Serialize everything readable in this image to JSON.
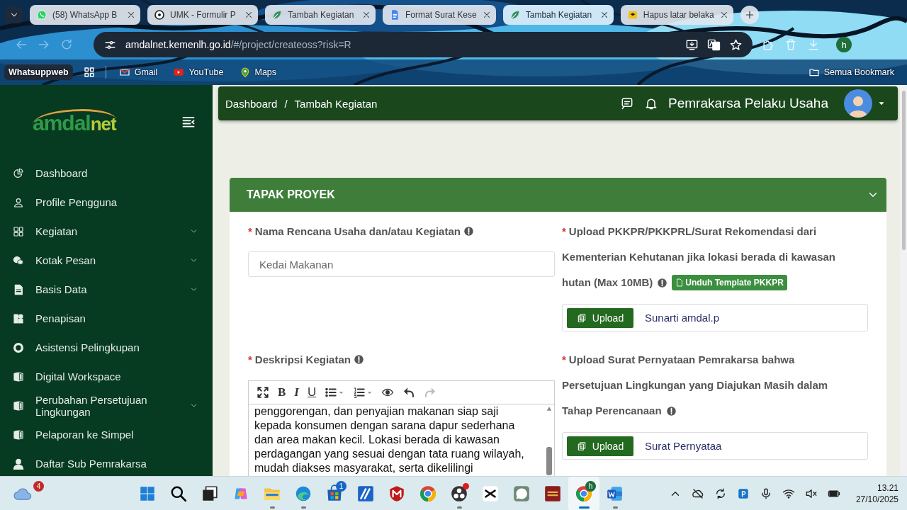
{
  "browser": {
    "tabs": [
      {
        "title": "(58) WhatsApp B",
        "kind": "chat",
        "selected": false
      },
      {
        "title": "UMK - Formulir P",
        "kind": "form",
        "selected": false
      },
      {
        "title": "Tambah Kegiatan",
        "kind": "leaf",
        "selected": false
      },
      {
        "title": "Format Surat Kese",
        "kind": "doc",
        "selected": false
      },
      {
        "title": "Tambah Kegiatan",
        "kind": "leaf",
        "selected": true
      },
      {
        "title": "Hapus latar belaka",
        "kind": "stack",
        "selected": false
      }
    ],
    "address": {
      "host": "amdalnet.kemenlh.go.id",
      "path": "/#/project/createoss?risk=R"
    },
    "profile_initial": "h",
    "bookmarks": [
      {
        "label": "Whatsuppweb",
        "kind": "chip"
      },
      {
        "label": "Gmail",
        "kind": "mail"
      },
      {
        "label": "YouTube",
        "kind": "video"
      },
      {
        "label": "Maps",
        "kind": "pin"
      }
    ],
    "all_bookmarks": "Semua Bookmark"
  },
  "app": {
    "logo": {
      "first": "amdal",
      "second": "net"
    },
    "sidebar": [
      {
        "label": "Dashboard",
        "kind": "pie",
        "has_submenu": false
      },
      {
        "label": "Profile Pengguna",
        "kind": "person",
        "has_submenu": false
      },
      {
        "label": "Kegiatan",
        "kind": "tiles",
        "has_submenu": true
      },
      {
        "label": "Kotak Pesan",
        "kind": "bubbles",
        "has_submenu": true
      },
      {
        "label": "Basis Data",
        "kind": "sheet",
        "has_submenu": true
      },
      {
        "label": "Penapisan",
        "kind": "squares",
        "has_submenu": false
      },
      {
        "label": "Asistensi Pelingkupan",
        "kind": "lifebuoy",
        "has_submenu": false
      },
      {
        "label": "Digital Workspace",
        "kind": "book",
        "has_submenu": false
      },
      {
        "label": "Perubahan Persetujuan Lingkungan",
        "kind": "book",
        "has_submenu": true
      },
      {
        "label": "Pelaporan ke Simpel",
        "kind": "book",
        "has_submenu": false
      },
      {
        "label": "Daftar Sub Pemrakarsa",
        "kind": "personfill",
        "has_submenu": false
      }
    ],
    "breadcrumb": {
      "items": [
        "Dashboard",
        "Tambah Kegiatan"
      ],
      "separator": "/"
    },
    "user": "Pemrakarsa Pelaku Usaha",
    "section": {
      "title": "TAPAK PROYEK",
      "expanded": true
    },
    "name_field": {
      "mark": "*",
      "label": "Nama Rencana Usaha dan/atau Kegiatan",
      "value": "Kedai Makanan"
    },
    "description": {
      "mark": "*",
      "label": "Deskripsi Kegiatan",
      "toolbar": [
        {
          "kind": "fullscreen",
          "disabled": false
        },
        {
          "kind": "bold",
          "label": "B",
          "disabled": false
        },
        {
          "kind": "italic",
          "label": "I",
          "disabled": false
        },
        {
          "kind": "underline",
          "label": "U",
          "disabled": false
        },
        {
          "kind": "bullets",
          "disabled": false
        },
        {
          "kind": "numbers",
          "disabled": false
        },
        {
          "kind": "preview",
          "disabled": false
        },
        {
          "kind": "undo",
          "disabled": false
        },
        {
          "kind": "redo",
          "disabled": true
        }
      ],
      "lines": [
        "penggorengan, dan penyajian makanan siap saji",
        "kepada konsumen dengan sarana dapur sederhana",
        "dan area makan kecil. Lokasi berada di kawasan",
        "perdagangan yang sesuai dengan tata ruang wilayah,",
        "mudah diakses masyarakat, serta dikelilingi"
      ]
    },
    "uploads": [
      {
        "mark": "*",
        "label_lines": [
          "Upload PKKPR/PKKPRL/Surat Rekomendasi dari",
          "Kementerian Kehutanan jika lokasi berada di kawasan",
          "hutan (Max 10MB)"
        ],
        "template_button": "Unduh Template PKKPR",
        "button": "Upload",
        "file": "Sunarti amdal.p"
      },
      {
        "mark": "*",
        "label_lines": [
          "Upload Surat Pernyataan Pemrakarsa bahwa",
          "Persetujuan Lingkungan yang Diajukan Masih dalam",
          "Tahap Perencanaan"
        ],
        "button": "Upload",
        "file": "Surat Pernyataa"
      }
    ]
  },
  "taskbar": {
    "weather_badge": "4",
    "apps": [
      {
        "kind": "start",
        "running": false,
        "selected": false,
        "dot": false
      },
      {
        "kind": "search",
        "running": false,
        "selected": false,
        "dot": false
      },
      {
        "kind": "taskview",
        "running": false,
        "selected": false,
        "dot": false
      },
      {
        "kind": "swirl",
        "running": false,
        "selected": false,
        "dot": false
      },
      {
        "kind": "folder",
        "running": true,
        "selected": false,
        "dot": false
      },
      {
        "kind": "wave",
        "running": true,
        "selected": false,
        "dot": false
      },
      {
        "kind": "bag",
        "running": false,
        "selected": false,
        "dot": false,
        "badge": "1"
      },
      {
        "kind": "tile",
        "running": false,
        "selected": false,
        "dot": false
      },
      {
        "kind": "shield",
        "running": false,
        "selected": false,
        "dot": false
      },
      {
        "kind": "browser",
        "running": false,
        "selected": false,
        "dot": false
      },
      {
        "kind": "record",
        "running": true,
        "selected": false,
        "dot": true
      },
      {
        "kind": "clip",
        "running": false,
        "selected": false,
        "dot": false
      },
      {
        "kind": "chat",
        "running": false,
        "selected": false,
        "dot": false
      },
      {
        "kind": "book",
        "running": false,
        "selected": false,
        "dot": false
      },
      {
        "kind": "browser",
        "running": true,
        "selected": true,
        "dot": false,
        "badge": "h"
      },
      {
        "kind": "word",
        "running": true,
        "selected": false,
        "dot": false
      }
    ],
    "time": "13.21",
    "date": "27/10/2025"
  }
}
